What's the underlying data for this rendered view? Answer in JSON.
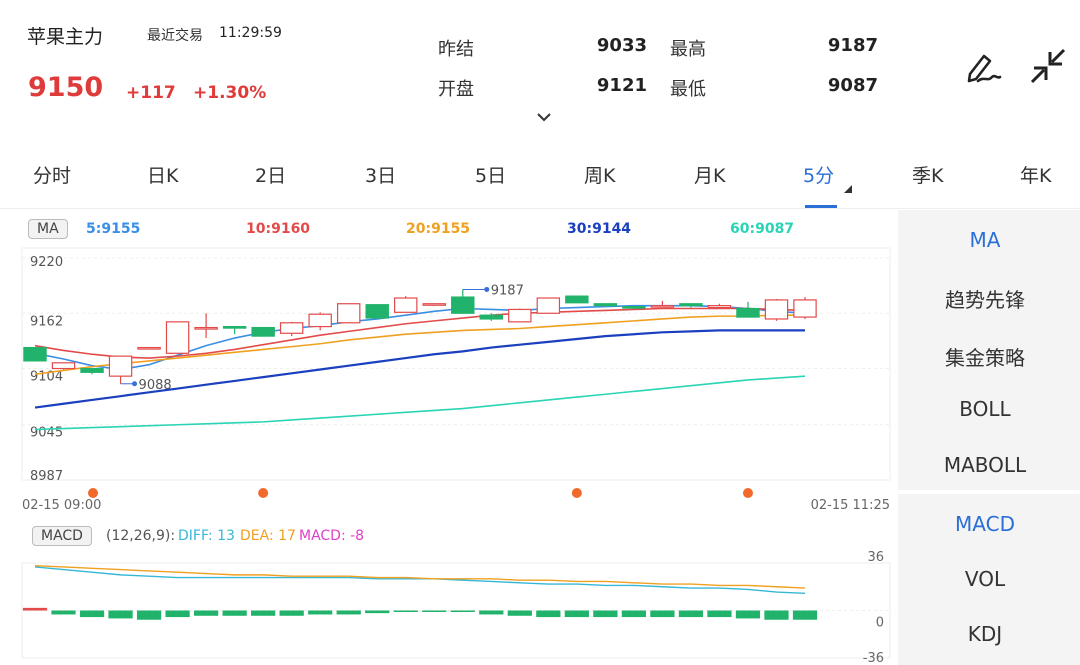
{
  "header": {
    "symbol": "苹果主力",
    "last_trade_label": "最近交易",
    "last_trade_time": "11:29:59",
    "price": "9150",
    "change": "+117",
    "change_pct": "+1.30%",
    "quote": [
      {
        "label": "昨结",
        "value": "9033"
      },
      {
        "label": "最高",
        "value": "9187"
      },
      {
        "label": "开盘",
        "value": "9121"
      },
      {
        "label": "最低",
        "value": "9087"
      }
    ],
    "icons": [
      "draw-pen-icon",
      "collapse-arrows-icon",
      "chevron-down-icon"
    ]
  },
  "tabs": [
    {
      "label": "分时"
    },
    {
      "label": "日K"
    },
    {
      "label": "2日"
    },
    {
      "label": "3日"
    },
    {
      "label": "5日"
    },
    {
      "label": "周K"
    },
    {
      "label": "月K"
    },
    {
      "label": "5分"
    },
    {
      "label": "季K"
    },
    {
      "label": "年K"
    }
  ],
  "active_tab": "5分",
  "ma_legend": {
    "tag": "MA",
    "items": [
      {
        "text": "5:9155",
        "color": "#3a8ee6"
      },
      {
        "text": "10:9160",
        "color": "#e34a4a"
      },
      {
        "text": "20:9155",
        "color": "#f0a020"
      },
      {
        "text": "30:9144",
        "color": "#1a3fbf"
      },
      {
        "text": "60:9087",
        "color": "#2ad4b4"
      }
    ]
  },
  "macd_legend": {
    "tag": "MACD",
    "params": "(12,26,9):",
    "diff": "DIFF: 13",
    "dea": "DEA: 17",
    "macd": "MACD: -8",
    "colors": {
      "diff": "#36b7d6",
      "dea": "#f0a020",
      "macd": "#e040c8"
    }
  },
  "sidebar": {
    "main_indicators": [
      "MA",
      "趋势先锋",
      "集金策略",
      "BOLL",
      "MABOLL"
    ],
    "sub_indicators": [
      "MACD",
      "VOL",
      "KDJ"
    ],
    "active_main": "MA",
    "active_sub": "MACD"
  },
  "chart_data": [
    {
      "type": "candlestick",
      "y_ticks": [
        "9220",
        "9162",
        "9104",
        "9045",
        "8987"
      ],
      "ylim": [
        8987,
        9220
      ],
      "x_start_label": "02-15 09:00",
      "x_end_label": "02-15 11:25",
      "annotations": [
        {
          "text": "9187",
          "value": 9187
        },
        {
          "text": "9088",
          "value": 9088
        }
      ],
      "colors": {
        "up": "#e34a4a",
        "down": "#21b36b",
        "marker": "#f26a2b"
      },
      "candles": [
        {
          "o": 9126,
          "c": 9112,
          "h": 9126,
          "l": 9112
        },
        {
          "o": 9104,
          "c": 9110,
          "h": 9110,
          "l": 9103
        },
        {
          "o": 9104,
          "c": 9100,
          "h": 9104,
          "l": 9098
        },
        {
          "o": 9096,
          "c": 9117,
          "h": 9117,
          "l": 9088
        },
        {
          "o": 9126,
          "c": 9126,
          "h": 9126,
          "l": 9126
        },
        {
          "o": 9120,
          "c": 9153,
          "h": 9153,
          "l": 9120
        },
        {
          "o": 9147,
          "c": 9147,
          "h": 9162,
          "l": 9136
        },
        {
          "o": 9148,
          "c": 9147,
          "h": 9148,
          "l": 9140
        },
        {
          "o": 9147,
          "c": 9138,
          "h": 9147,
          "l": 9138
        },
        {
          "o": 9141,
          "c": 9152,
          "h": 9153,
          "l": 9138
        },
        {
          "o": 9148,
          "c": 9161,
          "h": 9163,
          "l": 9144
        },
        {
          "o": 9152,
          "c": 9172,
          "h": 9172,
          "l": 9152
        },
        {
          "o": 9171,
          "c": 9157,
          "h": 9171,
          "l": 9157
        },
        {
          "o": 9163,
          "c": 9178,
          "h": 9180,
          "l": 9163
        },
        {
          "o": 9172,
          "c": 9172,
          "h": 9172,
          "l": 9172
        },
        {
          "o": 9179,
          "c": 9162,
          "h": 9187,
          "l": 9162
        },
        {
          "o": 9160,
          "c": 9156,
          "h": 9162,
          "l": 9154
        },
        {
          "o": 9153,
          "c": 9166,
          "h": 9167,
          "l": 9153
        },
        {
          "o": 9162,
          "c": 9178,
          "h": 9178,
          "l": 9162
        },
        {
          "o": 9180,
          "c": 9173,
          "h": 9180,
          "l": 9173
        },
        {
          "o": 9172,
          "c": 9170,
          "h": 9172,
          "l": 9170
        },
        {
          "o": 9169,
          "c": 9168,
          "h": 9170,
          "l": 9166
        },
        {
          "o": 9170,
          "c": 9170,
          "h": 9175,
          "l": 9170
        },
        {
          "o": 9172,
          "c": 9170,
          "h": 9172,
          "l": 9168
        },
        {
          "o": 9168,
          "c": 9170,
          "h": 9172,
          "l": 9168
        },
        {
          "o": 9167,
          "c": 9158,
          "h": 9174,
          "l": 9158
        },
        {
          "o": 9156,
          "c": 9176,
          "h": 9177,
          "l": 9154
        },
        {
          "o": 9158,
          "c": 9176,
          "h": 9179,
          "l": 9156
        }
      ],
      "ma_series": [
        {
          "name": "5",
          "color": "#3a8ee6",
          "values": [
            9120,
            9114,
            9107,
            9103,
            9108,
            9118,
            9128,
            9136,
            9142,
            9146,
            9149,
            9153,
            9156,
            9160,
            9164,
            9167,
            9166,
            9165,
            9167,
            9168,
            9169,
            9170,
            9170,
            9170,
            9169,
            9167,
            9164,
            9162
          ]
        },
        {
          "name": "10",
          "color": "#e34a4a",
          "values": [
            9128,
            9123,
            9119,
            9116,
            9115,
            9117,
            9120,
            9124,
            9129,
            9134,
            9139,
            9143,
            9147,
            9151,
            9154,
            9157,
            9160,
            9162,
            9163,
            9164,
            9165,
            9166,
            9167,
            9167,
            9167,
            9167,
            9166,
            9165
          ]
        },
        {
          "name": "20",
          "color": "#f0a020",
          "values": [
            9098,
            9102,
            9106,
            9109,
            9112,
            9115,
            9118,
            9121,
            9124,
            9127,
            9130,
            9134,
            9137,
            9140,
            9142,
            9144,
            9145,
            9146,
            9148,
            9150,
            9152,
            9154,
            9156,
            9158,
            9159,
            9159,
            9160,
            9160
          ]
        },
        {
          "name": "30",
          "color": "#1a3fbf",
          "values": [
            9063,
            9067,
            9071,
            9075,
            9079,
            9083,
            9087,
            9091,
            9095,
            9099,
            9103,
            9107,
            9111,
            9115,
            9119,
            9122,
            9126,
            9129,
            9132,
            9135,
            9138,
            9140,
            9142,
            9143,
            9144,
            9144,
            9144,
            9144
          ]
        },
        {
          "name": "60",
          "color": "#2ad4b4",
          "values": [
            9040,
            9041,
            9042,
            9043,
            9044,
            9045,
            9046,
            9047,
            9048,
            9050,
            9052,
            9054,
            9056,
            9058,
            9060,
            9062,
            9065,
            9068,
            9071,
            9074,
            9077,
            9080,
            9083,
            9086,
            9089,
            9092,
            9094,
            9096
          ]
        }
      ],
      "markers": [
        0,
        8,
        19,
        25
      ]
    },
    {
      "type": "bar",
      "y_ticks": [
        "36",
        "0",
        "-36"
      ],
      "ylim": [
        -36,
        36
      ],
      "macd_values": [
        2,
        -3,
        -5,
        -6,
        -7,
        -5,
        -4,
        -4,
        -4,
        -4,
        -3,
        -3,
        -2,
        -1,
        -1,
        -1,
        -3,
        -4,
        -5,
        -5,
        -5,
        -5,
        -5,
        -5,
        -5,
        -6,
        -7,
        -7
      ],
      "series": [
        {
          "name": "DIFF",
          "color": "#36b7d6",
          "values": [
            33,
            31,
            29,
            27,
            26,
            25,
            25,
            25,
            25,
            25,
            25,
            25,
            24,
            24,
            24,
            23,
            22,
            21,
            20,
            20,
            19,
            19,
            18,
            17,
            17,
            16,
            14,
            13
          ]
        },
        {
          "name": "DEA",
          "color": "#f0a020",
          "values": [
            34,
            33,
            32,
            31,
            30,
            29,
            28,
            27,
            27,
            26,
            26,
            26,
            25,
            25,
            24,
            24,
            24,
            23,
            23,
            22,
            22,
            21,
            20,
            20,
            19,
            19,
            18,
            17
          ]
        }
      ]
    }
  ]
}
